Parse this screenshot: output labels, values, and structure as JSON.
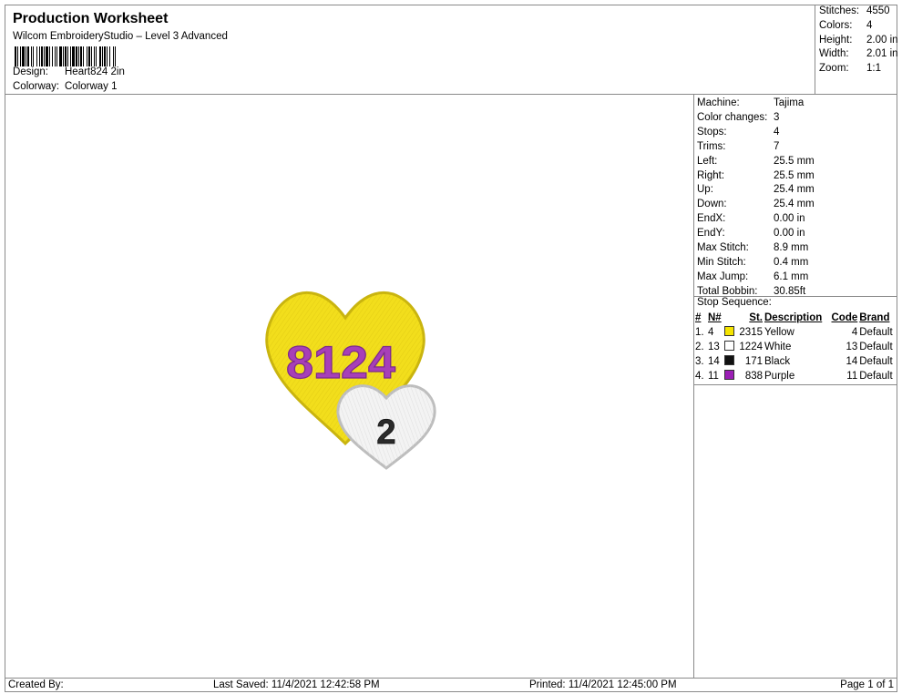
{
  "header": {
    "title": "Production Worksheet",
    "subtitle": "Wilcom EmbroideryStudio – Level 3 Advanced",
    "design_label": "Design:",
    "design_value": "Heart824 2in",
    "colorway_label": "Colorway:",
    "colorway_value": "Colorway 1"
  },
  "summary": [
    {
      "label": "Stitches:",
      "value": "4550"
    },
    {
      "label": "Colors:",
      "value": "4"
    },
    {
      "label": "Height:",
      "value": "2.00 in"
    },
    {
      "label": "Width:",
      "value": "2.01 in"
    },
    {
      "label": "Zoom:",
      "value": "1:1"
    }
  ],
  "machine_info": [
    {
      "label": "Machine:",
      "value": "Tajima"
    },
    {
      "label": "Color changes:",
      "value": "3"
    },
    {
      "label": "Stops:",
      "value": "4"
    },
    {
      "label": "Trims:",
      "value": "7"
    },
    {
      "label": "Left:",
      "value": "25.5 mm"
    },
    {
      "label": "Right:",
      "value": "25.5 mm"
    },
    {
      "label": "Up:",
      "value": "25.4 mm"
    },
    {
      "label": "Down:",
      "value": "25.4 mm"
    },
    {
      "label": "EndX:",
      "value": "0.00 in"
    },
    {
      "label": "EndY:",
      "value": "0.00 in"
    },
    {
      "label": "Max Stitch:",
      "value": "8.9 mm"
    },
    {
      "label": "Min Stitch:",
      "value": "0.4 mm"
    },
    {
      "label": "Max Jump:",
      "value": "6.1 mm"
    },
    {
      "label": "Total Bobbin:",
      "value": "30.85ft"
    }
  ],
  "stop_sequence": {
    "title": "Stop Sequence:",
    "headers": {
      "num": "#",
      "needle": "N#",
      "stitches": "St.",
      "description": "Description",
      "code": "Code",
      "brand": "Brand"
    },
    "rows": [
      {
        "num": "1.",
        "needle": "4",
        "color": "#f5e400",
        "stitches": "2315",
        "description": "Yellow",
        "code": "4",
        "brand": "Default"
      },
      {
        "num": "2.",
        "needle": "13",
        "color": "#ffffff",
        "stitches": "1224",
        "description": "White",
        "code": "13",
        "brand": "Default"
      },
      {
        "num": "3.",
        "needle": "14",
        "color": "#111111",
        "stitches": "171",
        "description": "Black",
        "code": "14",
        "brand": "Default"
      },
      {
        "num": "4.",
        "needle": "11",
        "color": "#9b1fb5",
        "stitches": "838",
        "description": "Purple",
        "code": "11",
        "brand": "Default"
      }
    ]
  },
  "design_preview": {
    "big_heart_text": "8124",
    "small_heart_text": "2",
    "colors": {
      "yellow": "#f2de1c",
      "purple": "#a73fb8",
      "white": "#f3f3f3",
      "black": "#2b2b2b"
    }
  },
  "footer": {
    "created_by": "Created By:",
    "last_saved": "Last Saved: 11/4/2021 12:42:58 PM",
    "printed": "Printed: 11/4/2021 12:45:00 PM",
    "page": "Page 1 of 1"
  }
}
